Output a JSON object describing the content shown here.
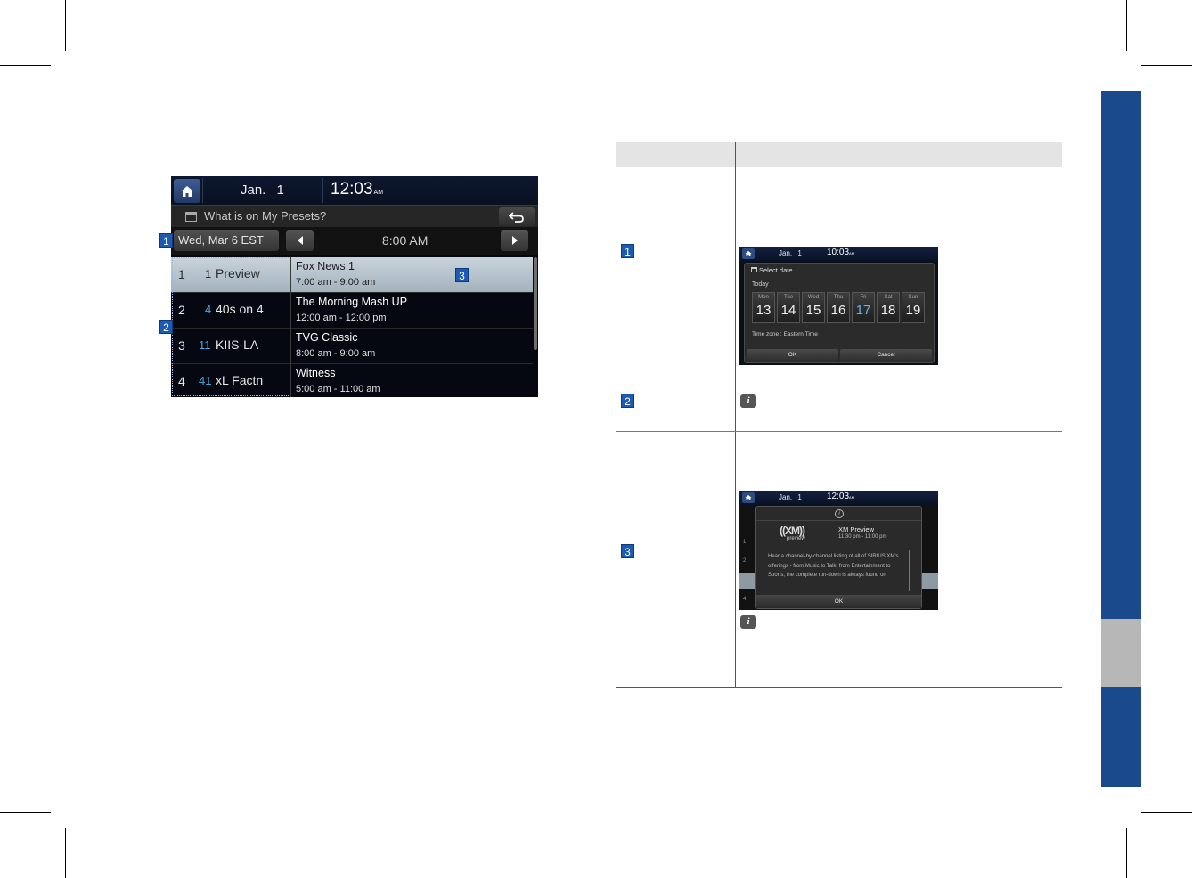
{
  "colors": {
    "side_tab_blue": "#1b4a8c",
    "side_tab_gray": "#b7b7b7",
    "badge_blue": "#1c5bb0",
    "accent_channel": "#4aa9e0"
  },
  "main_screen": {
    "top_date": "Jan. 1",
    "top_time": "12:03",
    "top_ampm": "AM",
    "title": "What is on My Presets?",
    "date_button": "Wed, Mar 6 EST",
    "time_slot": "8:00 AM",
    "channels": [
      {
        "index": "1",
        "number": "1",
        "name": "Preview",
        "program": "Fox News 1",
        "time": "7:00 am - 9:00 am",
        "selected": true
      },
      {
        "index": "2",
        "number": "4",
        "name": "40s on 4",
        "program": "The Morning Mash UP",
        "time": "12:00 am - 12:00 pm",
        "selected": false
      },
      {
        "index": "3",
        "number": "11",
        "name": "KIIS-LA",
        "program": "TVG Classic",
        "time": "8:00 am - 9:00 am",
        "selected": false
      },
      {
        "index": "4",
        "number": "41",
        "name": "xL Factn",
        "program": "Witness",
        "time": "5:00 am - 11:00 am",
        "selected": false
      }
    ],
    "badges": [
      "1",
      "2",
      "3"
    ]
  },
  "table": {
    "rows": [
      {
        "badge": "1"
      },
      {
        "badge": "2"
      },
      {
        "badge": "3"
      }
    ]
  },
  "mini_select_date": {
    "top_date": "Jan. 1",
    "top_time": "10:03",
    "top_ampm": "AM",
    "title": "Select date",
    "today_label": "Today",
    "days": [
      {
        "name": "Mon",
        "num": "13"
      },
      {
        "name": "Tue",
        "num": "14"
      },
      {
        "name": "Wed",
        "num": "15"
      },
      {
        "name": "Thu",
        "num": "16"
      },
      {
        "name": "Fri",
        "num": "17"
      },
      {
        "name": "Sat",
        "num": "18"
      },
      {
        "name": "Sun",
        "num": "19"
      }
    ],
    "timezone": "Time zone : Eastern Time",
    "ok": "OK",
    "cancel": "Cancel"
  },
  "mini_xm_preview": {
    "top_date": "Jan. 1",
    "top_time": "12:03",
    "top_ampm": "AM",
    "logo_text": "((XM))",
    "logo_sub": "preview",
    "info_glyph": "i",
    "title": "XM Preview",
    "time": "11:30 pm - 11:00 pm",
    "description": "Hear a channel-by-channel listing of all of SIRIUS XM's offerings - from Music to Talk, from Entertainment to Sports, the complete run-down is always found on",
    "ok": "OK",
    "bg_rows": [
      "1",
      "2",
      "3",
      "4"
    ]
  },
  "info_glyph": "i"
}
